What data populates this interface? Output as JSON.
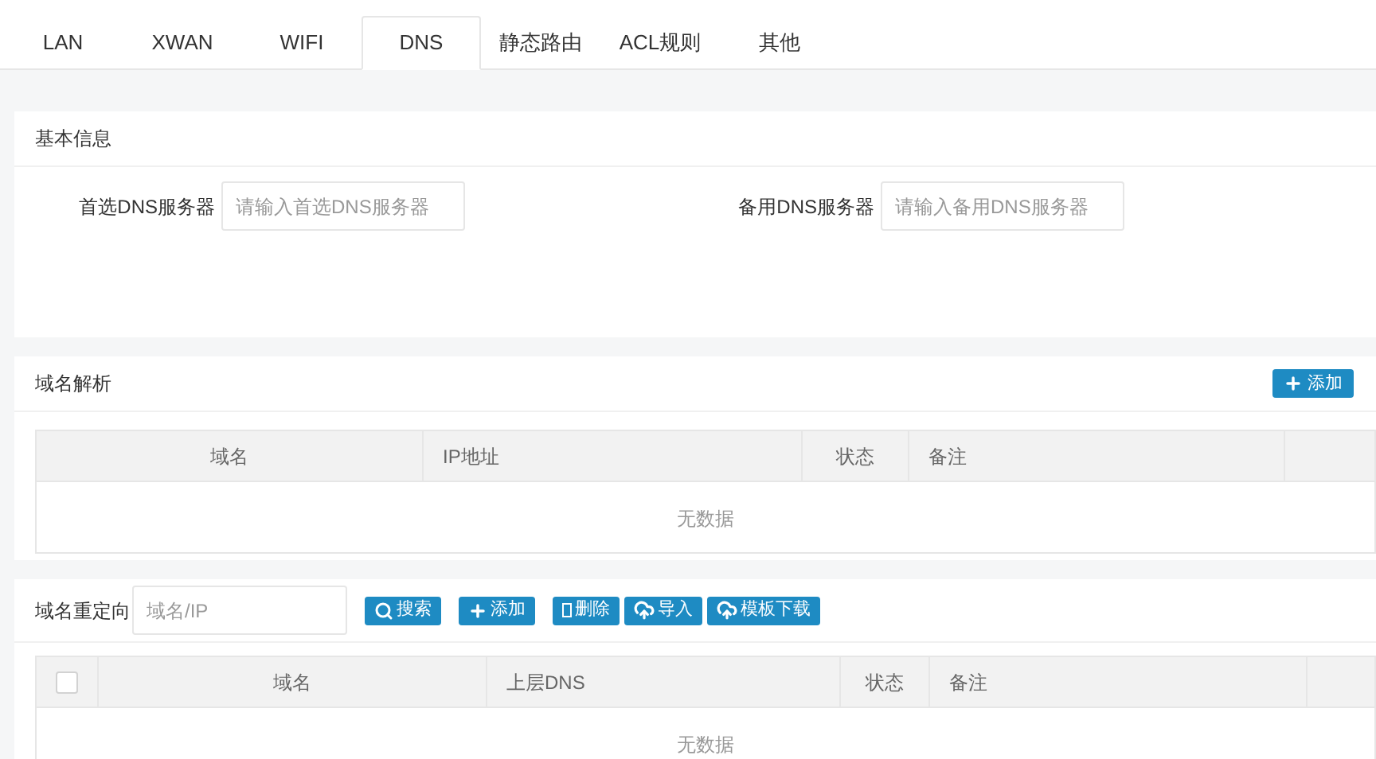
{
  "tabs": [
    {
      "label": "LAN",
      "selected": false
    },
    {
      "label": "XWAN",
      "selected": false
    },
    {
      "label": "WIFI",
      "selected": false
    },
    {
      "label": "DNS",
      "selected": true
    },
    {
      "label": "静态路由",
      "selected": false
    },
    {
      "label": "ACL规则",
      "selected": false
    },
    {
      "label": "其他",
      "selected": false
    }
  ],
  "basic_info": {
    "title": "基本信息",
    "fields": [
      {
        "label": "首选DNS服务器",
        "placeholder": "请输入首选DNS服务器"
      },
      {
        "label": "备用DNS服务器",
        "placeholder": "请输入备用DNS服务器"
      }
    ]
  },
  "domain_resolution": {
    "title": "域名解析",
    "add_button": "添加",
    "table": {
      "columns": [
        "域名",
        "IP地址",
        "状态",
        "备注"
      ],
      "empty_text": "无数据"
    }
  },
  "domain_redirect": {
    "title": "域名重定向",
    "search": {
      "placeholder": "域名/IP"
    },
    "buttons": [
      {
        "kind": "search",
        "label": "搜索"
      },
      {
        "kind": "add",
        "label": "添加"
      },
      {
        "kind": "delete",
        "label": "删除"
      },
      {
        "kind": "upload",
        "label": "导入"
      },
      {
        "kind": "upload",
        "label": "模板下载"
      }
    ],
    "table": {
      "select_all": {
        "checked": false
      },
      "columns": [
        "域名",
        "上层DNS",
        "状态",
        "备注"
      ],
      "empty_text": "无数据"
    }
  }
}
